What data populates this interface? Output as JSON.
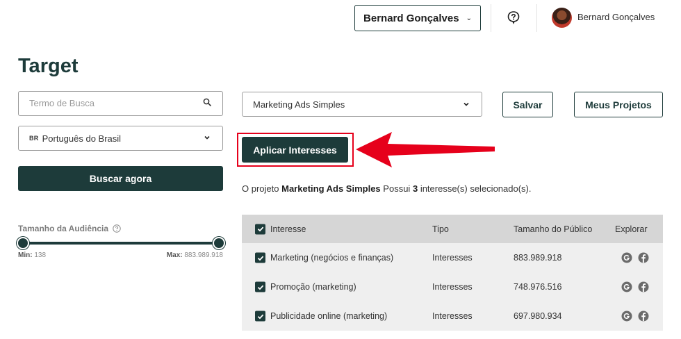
{
  "header": {
    "account_select": "Bernard Gonçalves",
    "user_name": "Bernard Gonçalves",
    "icons": {
      "help": "question-icon",
      "avatar": "user-avatar"
    }
  },
  "page": {
    "title": "Target"
  },
  "sidebar": {
    "search_placeholder": "Termo de Busca",
    "language_flag": "BR",
    "language": "Português do Brasil",
    "search_button": "Buscar agora",
    "audience_label": "Tamanho da Audiência",
    "slider": {
      "min_label": "Min:",
      "min_value": "138",
      "max_label": "Max:",
      "max_value": "883.989.918"
    }
  },
  "main": {
    "project_select": "Marketing Ads Simples",
    "save_button": "Salvar",
    "projects_button": "Meus Projetos",
    "apply_button": "Aplicar Interesses",
    "summary": {
      "prefix": "O projeto",
      "project": "Marketing Ads Simples",
      "middle": "Possui",
      "count": "3",
      "suffix": "interesse(s) selecionado(s)."
    },
    "table": {
      "headers": [
        "Interesse",
        "Tipo",
        "Tamanho do Público",
        "Explorar"
      ],
      "rows": [
        {
          "name": "Marketing (negócios e finanças)",
          "type": "Interesses",
          "size": "883.989.918"
        },
        {
          "name": "Promoção (marketing)",
          "type": "Interesses",
          "size": "748.976.516"
        },
        {
          "name": "Publicidade online (marketing)",
          "type": "Interesses",
          "size": "697.980.934"
        }
      ]
    }
  },
  "colors": {
    "primary": "#1d3b3a",
    "highlight": "#e6001b",
    "table_header": "#d6d6d6",
    "table_row": "#efefef"
  }
}
